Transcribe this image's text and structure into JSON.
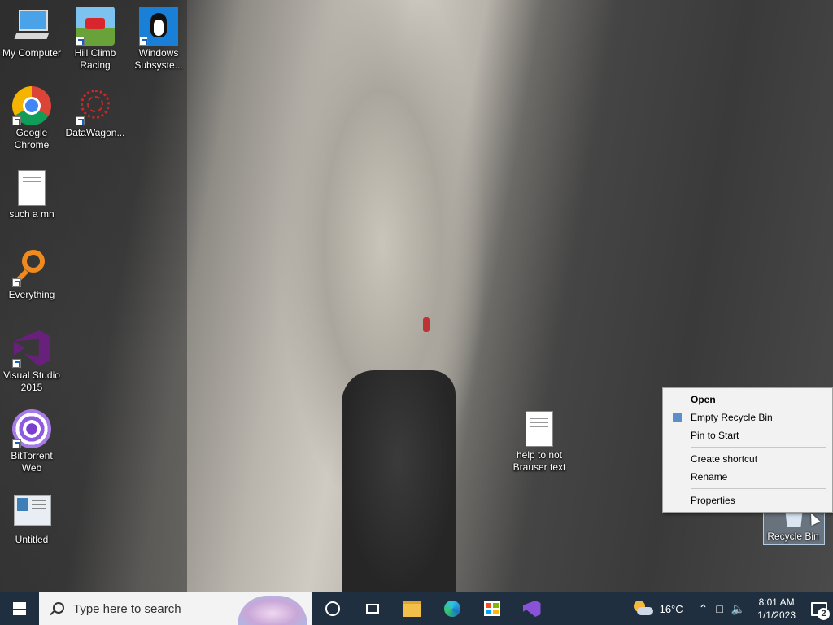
{
  "desktop": {
    "icons": [
      {
        "label": "My Computer",
        "icon": "computer-icon"
      },
      {
        "label": "Hill Climb Racing",
        "icon": "hill-climb-racing-icon"
      },
      {
        "label": "Windows Subsyste...",
        "icon": "tux-penguin-icon"
      },
      {
        "label": "Google Chrome",
        "icon": "chrome-icon"
      },
      {
        "label": "DataWagon...",
        "icon": "datawagon-icon"
      },
      {
        "label": "such a mn",
        "icon": "text-document-icon"
      },
      {
        "label": "Everything",
        "icon": "everything-search-icon"
      },
      {
        "label": "Visual Studio 2015",
        "icon": "visual-studio-icon"
      },
      {
        "label": "BitTorrent Web",
        "icon": "bittorrent-icon"
      },
      {
        "label": "Untitled",
        "icon": "image-thumbnail-icon"
      },
      {
        "label": "help to not Brauser text",
        "icon": "text-document-icon"
      },
      {
        "label": "Recycle Bin",
        "icon": "recycle-bin-icon"
      }
    ]
  },
  "context_menu": {
    "items": [
      {
        "label": "Open",
        "bold": true
      },
      {
        "label": "Empty Recycle Bin",
        "icon": "recycle-bin-small-icon"
      },
      {
        "label": "Pin to Start"
      },
      {
        "label": "Create shortcut"
      },
      {
        "label": "Rename"
      },
      {
        "label": "Properties"
      }
    ]
  },
  "taskbar": {
    "search_placeholder": "Type here to search",
    "weather_temp": "16°C",
    "time": "8:01 AM",
    "date": "1/1/2023",
    "notification_count": "2",
    "colors": {
      "background": "#1f2f3f",
      "search_bg": "#f3f3f3"
    }
  }
}
